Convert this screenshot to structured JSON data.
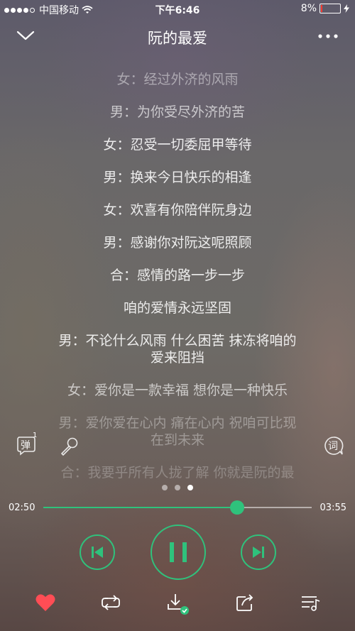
{
  "status_bar": {
    "carrier": "中国移动",
    "time": "下午6:46",
    "battery_percent": "8%",
    "battery_level": 0.08,
    "signal_bars": 4,
    "battery_color": "#ff3b30"
  },
  "header": {
    "title": "阮的最爱"
  },
  "lyrics": [
    "女：经过外济的风雨",
    "男：为你受尽外济的苦",
    "女：忍受一切委屈甲等待",
    "男：换来今日快乐的相逢",
    "女：欢喜有你陪伴阮身边",
    "男：感谢你对阮这呢照顾",
    "合：感情的路一步一步",
    "咱的爱情永远坚固",
    "男：不论什么风雨 什么困苦 抹冻将咱的爱来阻挡",
    "女：爱你是一款幸福 想你是一种快乐",
    "男：爱你爱在心内 痛在心内 祝咱可比现在到未来",
    "合：我要乎所有人拢了解 你就是阮的最"
  ],
  "side_buttons": {
    "danmu_label": "弹",
    "danmu_count": "1",
    "lyric_label": "词"
  },
  "pager": {
    "count": 3,
    "active_index": 2
  },
  "progress": {
    "current": "02:50",
    "total": "03:55",
    "fraction": 0.7234
  },
  "colors": {
    "accent": "#2fc27c",
    "favorite": "#ff4d55"
  },
  "icons": {
    "back": "chevron-down-icon",
    "more": "more-dots-icon",
    "prev": "skip-previous-icon",
    "pause": "pause-icon",
    "next": "skip-next-icon",
    "favorite": "heart-icon",
    "mode": "repeat-icon",
    "download": "download-icon",
    "share": "share-icon",
    "playlist": "playlist-icon",
    "karaoke": "microphone-icon"
  }
}
